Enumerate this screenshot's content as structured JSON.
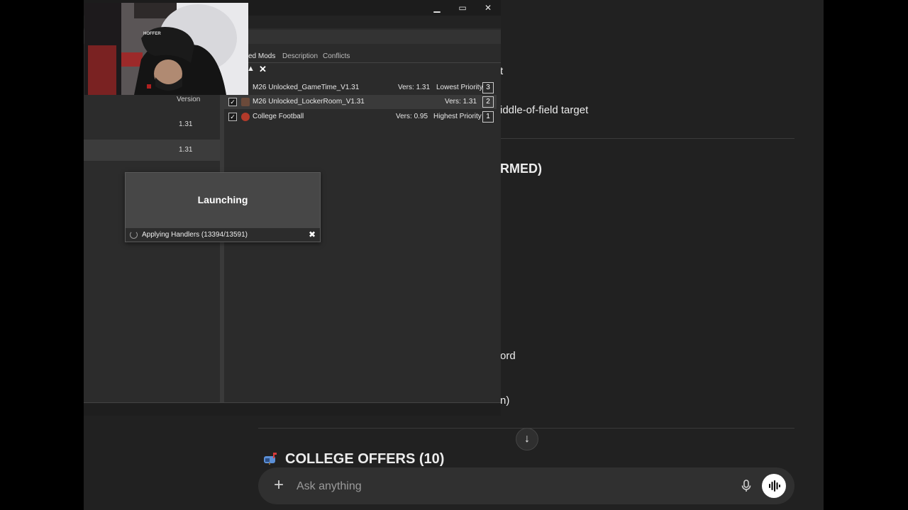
{
  "chat": {
    "fragment_1": "t",
    "fragment_2": "iddle-of-field target",
    "fragment_3": "RMED)",
    "fragment_4": "ord",
    "fragment_5": "n)",
    "offers_heading": "COLLEGE OFFERS (10)",
    "ask_placeholder": "Ask anything",
    "plus_symbol": "+",
    "scroll_symbol": "↓"
  },
  "mod_window": {
    "left_header": "Version",
    "left_rows": [
      "1.31",
      "1.31"
    ],
    "tabs": [
      {
        "label": "ed Mods",
        "active": true
      },
      {
        "label": "Description",
        "active": false
      },
      {
        "label": "Conflicts",
        "active": false
      }
    ],
    "mods": [
      {
        "checked": true,
        "name": "M26 Unlocked_GameTime_V1.31",
        "version": "Vers: 1.31",
        "priority_label": "Lowest Priority",
        "priority": "3",
        "icon_color": "#2a2a2a"
      },
      {
        "checked": true,
        "name": "M26 Unlocked_LockerRoom_V1.31",
        "version": "Vers: 1.31",
        "priority_label": "",
        "priority": "2",
        "icon_color": "#6b4a3a"
      },
      {
        "checked": true,
        "name": "College Football",
        "version": "Vers: 0.95",
        "priority_label": "Highest Priority",
        "priority": "1",
        "icon_color": "#b23a2a"
      }
    ]
  },
  "launch_dialog": {
    "title": "Launching",
    "status": "Applying Handlers (13394/13591)"
  },
  "webcam": {
    "cap_text": "HOFFER"
  }
}
